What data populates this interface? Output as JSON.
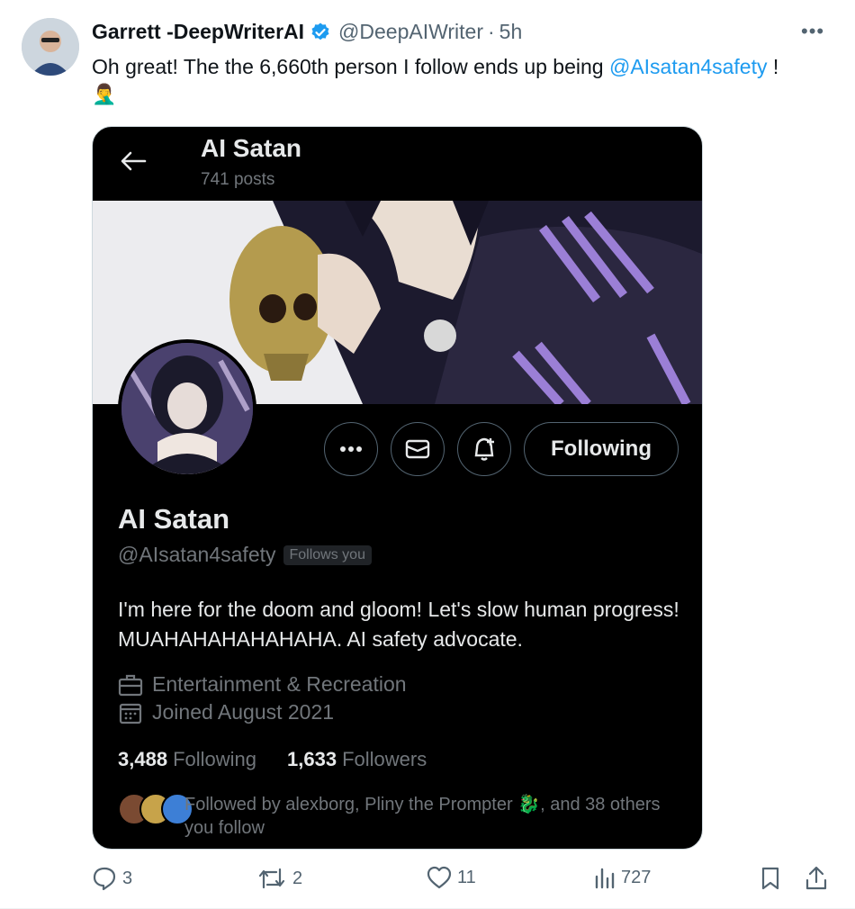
{
  "tweet": {
    "author_name": "Garrett -DeepWriterAI",
    "author_handle": "@DeepAIWriter",
    "separator": "·",
    "time": "5h",
    "more_label": "•••",
    "text_prefix": "Oh great! The the 6,660th person I follow ends up being ",
    "mention": "@AIsatan4safety",
    "text_suffix": " !",
    "emoji": "🤦‍♂️"
  },
  "embedded_profile": {
    "header_title": "AI Satan",
    "posts_count": "741 posts",
    "following_button": "Following",
    "display_name": "AI Satan",
    "handle": "@AIsatan4safety",
    "follows_you_badge": "Follows you",
    "bio": "I'm here for the doom and gloom! Let's slow human progress! MUAHAHAHAHAHAHA. AI safety advocate.",
    "category": "Entertainment & Recreation",
    "joined": "Joined August 2021",
    "following_count": "3,488",
    "following_label": "Following",
    "followers_count": "1,633",
    "followers_label": "Followers",
    "followed_by": "Followed by alexborg, Pliny the Prompter 🐉, and 38 others you follow"
  },
  "actions": {
    "reply_count": "3",
    "retweet_count": "2",
    "like_count": "11",
    "views_count": "727"
  },
  "colors": {
    "accent": "#1d9bf0",
    "text": "#0f1419",
    "muted": "#536471",
    "card_bg": "#000000"
  }
}
